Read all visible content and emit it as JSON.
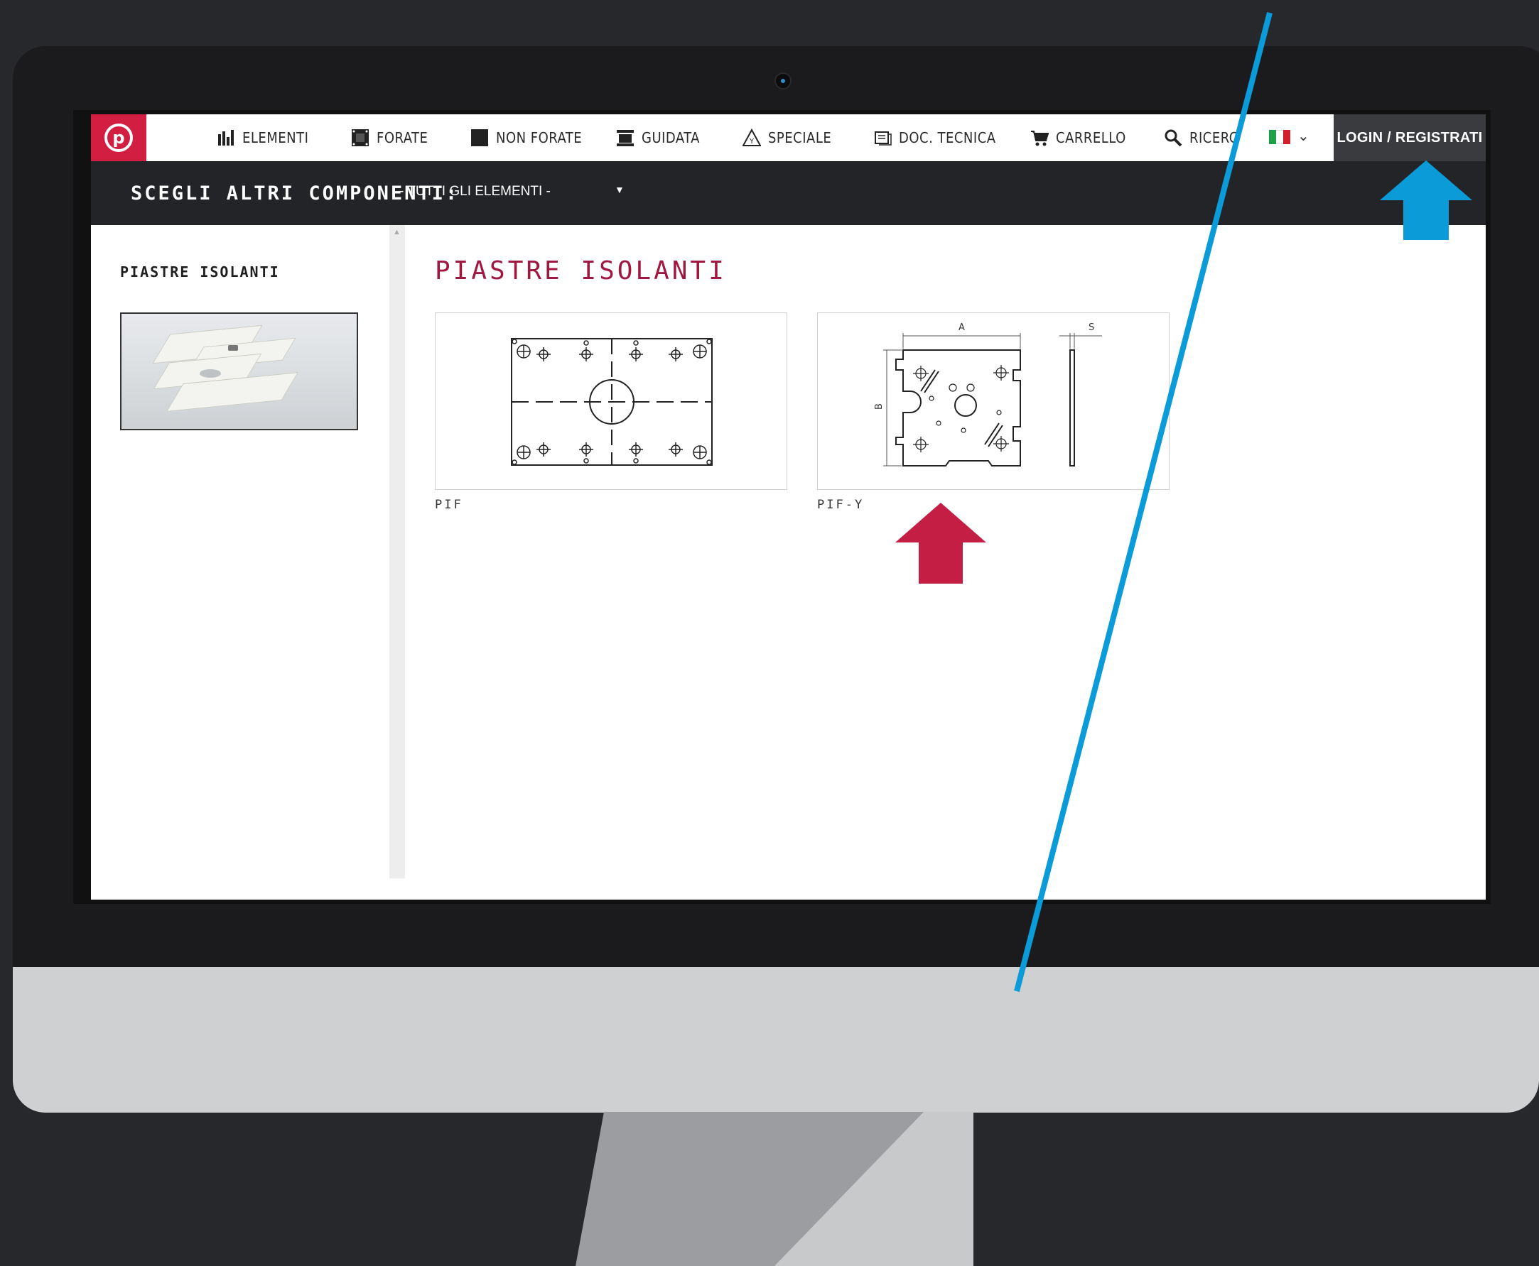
{
  "nav": {
    "items": [
      {
        "label": "ELEMENTI",
        "icon": "bar-chart-icon"
      },
      {
        "label": "FORATE",
        "icon": "frame-icon"
      },
      {
        "label": "NON FORATE",
        "icon": "solid-square-icon"
      },
      {
        "label": "GUIDATA",
        "icon": "guide-icon"
      },
      {
        "label": "SPECIALE",
        "icon": "warning-triangle-icon"
      },
      {
        "label": "DOC. TECNICA",
        "icon": "document-icon"
      },
      {
        "label": "CARRELLO",
        "icon": "cart-icon"
      },
      {
        "label": "RICERC",
        "icon": "search-icon"
      }
    ],
    "login_label": "LOGIN / REGISTRATI",
    "language_flag_colors": [
      "#1f9f4a",
      "#ffffff",
      "#d21f2d"
    ]
  },
  "selector": {
    "label": "SCEGLI ALTRI COMPONENTI:",
    "value": "- TUTTI GLI ELEMENTI -"
  },
  "sidebar": {
    "title": "PIASTRE ISOLANTI"
  },
  "main": {
    "title": "PIASTRE ISOLANTI",
    "products": [
      {
        "label": "PIF"
      },
      {
        "label": "PIF-Y",
        "dim_a": "A",
        "dim_b": "B",
        "dim_s": "S"
      }
    ]
  },
  "colors": {
    "accent_red": "#c41e45",
    "annotation_blue": "#0a9bd8",
    "annotation_red": "#c41e45"
  }
}
